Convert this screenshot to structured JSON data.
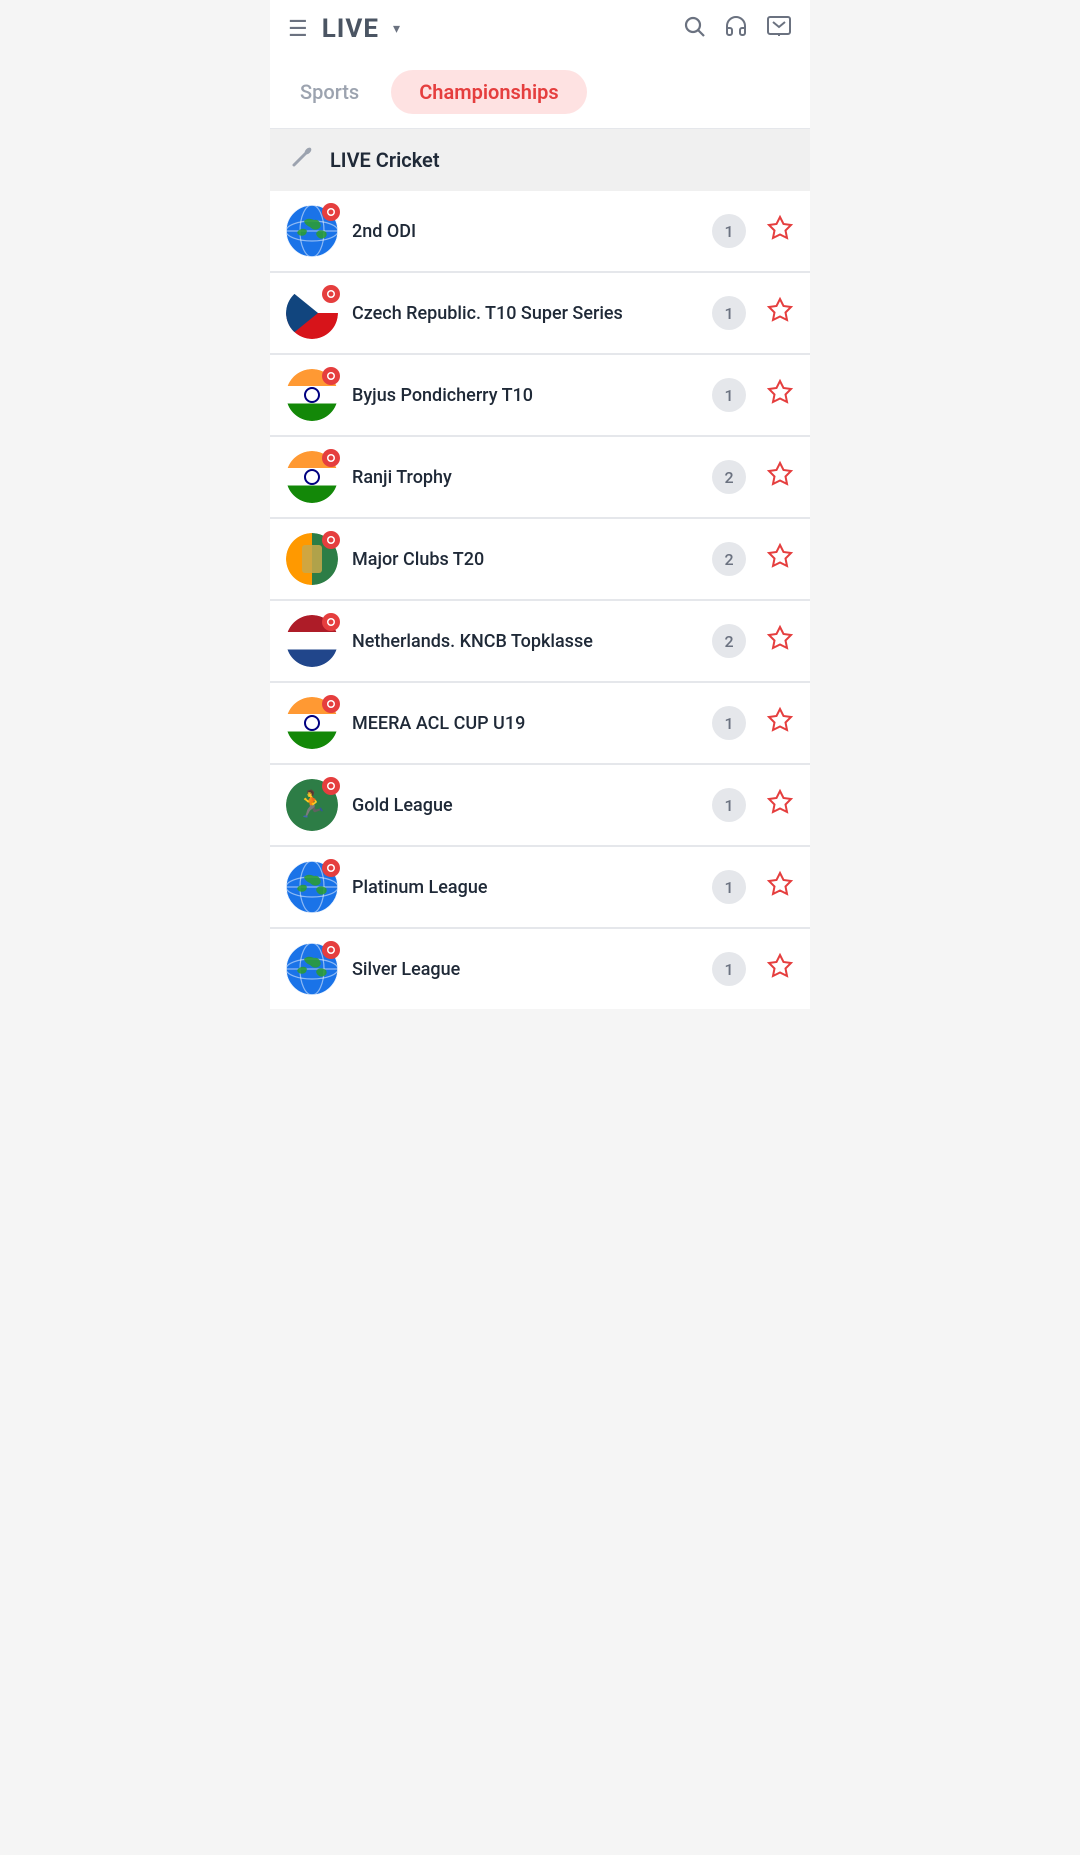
{
  "header": {
    "title": "LIVE",
    "chevron": "▾"
  },
  "tabs": {
    "sports": "Sports",
    "championships": "Championships"
  },
  "section": {
    "title": "LIVE Cricket"
  },
  "items": [
    {
      "id": 1,
      "name": "2nd ODI",
      "count": 1,
      "flag": "globe"
    },
    {
      "id": 2,
      "name": "Czech Republic. T10 Super Series",
      "count": 1,
      "flag": "czech"
    },
    {
      "id": 3,
      "name": "Byjus Pondicherry T10",
      "count": 1,
      "flag": "india"
    },
    {
      "id": 4,
      "name": "Ranji Trophy",
      "count": 2,
      "flag": "india"
    },
    {
      "id": 5,
      "name": "Major Clubs T20",
      "count": 2,
      "flag": "orangegreen"
    },
    {
      "id": 6,
      "name": "Netherlands. KNCB Topklasse",
      "count": 2,
      "flag": "netherlands"
    },
    {
      "id": 7,
      "name": "MEERA ACL CUP U19",
      "count": 1,
      "flag": "india"
    },
    {
      "id": 8,
      "name": "Gold League",
      "count": 1,
      "flag": "person"
    },
    {
      "id": 9,
      "name": "Platinum League",
      "count": 1,
      "flag": "globe"
    },
    {
      "id": 10,
      "name": "Silver League",
      "count": 1,
      "flag": "globe"
    }
  ]
}
